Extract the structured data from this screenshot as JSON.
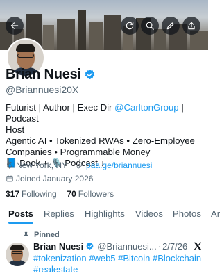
{
  "icons": {
    "back": "arrow-left-icon",
    "refresh": "refresh-icon",
    "search": "search-icon",
    "edit": "pencil-icon",
    "share": "share-icon",
    "verified": "verified-badge-icon",
    "location": "location-pin-icon",
    "link": "link-icon",
    "calendar": "calendar-icon",
    "pin": "pin-icon",
    "x_logo": "x-logo-icon"
  },
  "colors": {
    "accent": "#1d9bf0",
    "text": "#0f1419",
    "muted": "#536471"
  },
  "profile": {
    "name": "Brian Nuesi",
    "handle": "@Briannuesi20X",
    "bio_line1_prefix": "Futurist | Author | Exec Dir ",
    "bio_line1_link": "@CarltonGroup",
    "bio_line1_suffix": " | Podcast",
    "bio_line2": "Host",
    "bio_line3": "Agentic AI • Tokenized RWAs • Zero-Employee",
    "bio_line4": "Companies • Programmable Money",
    "bio_line5": "📘 Book + 🎙️ Podcast ↓",
    "location": "New York, NY",
    "website": "paa.ge/briannuesi",
    "joined": "Joined January 2026",
    "following_count": "317",
    "following_label": "Following",
    "followers_count": "70",
    "followers_label": "Followers"
  },
  "tabs": [
    {
      "label": "Posts"
    },
    {
      "label": "Replies"
    },
    {
      "label": "Highlights"
    },
    {
      "label": "Videos"
    },
    {
      "label": "Photos"
    },
    {
      "label": "Ar"
    }
  ],
  "pinned_post": {
    "pinned_label": "Pinned",
    "author_name": "Brian Nuesi",
    "author_handle": "@Briannuesi...",
    "separator": "·",
    "date": "2/7/26",
    "text_line1": "#tokenization #web5 #Bitcoin #Blockchain",
    "text_line2": "#realestate"
  }
}
